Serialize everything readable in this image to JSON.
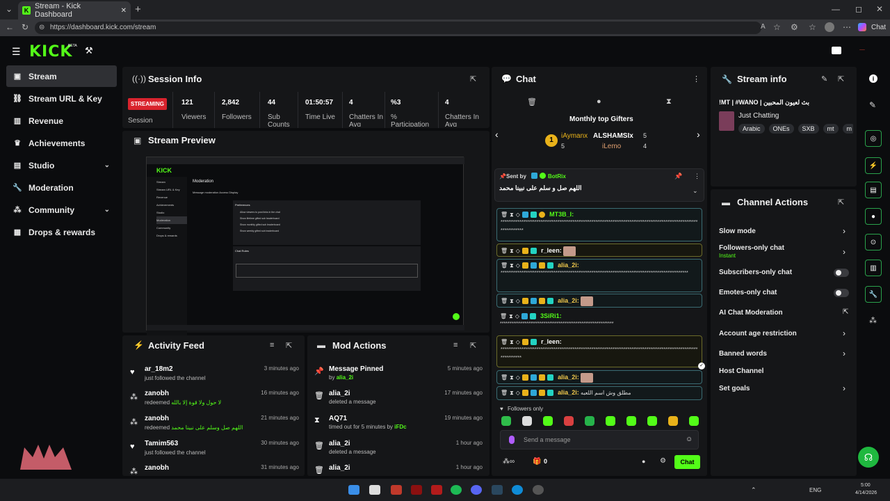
{
  "browser": {
    "tab_title": "Stream - Kick Dashboard",
    "url": "https://dashboard.kick.com/stream",
    "profile_label": "Chat",
    "new_tab": "+",
    "close_tab": "✕"
  },
  "brand": {
    "logo": "KICK",
    "beta": "BETA",
    "accent": "#53fc18"
  },
  "sidebar": {
    "items": [
      {
        "label": "Stream",
        "icon": "stream-icon"
      },
      {
        "label": "Stream URL & Key",
        "icon": "link-icon"
      },
      {
        "label": "Revenue",
        "icon": "chart-icon"
      },
      {
        "label": "Achievements",
        "icon": "trophy-icon"
      },
      {
        "label": "Studio",
        "icon": "studio-icon"
      },
      {
        "label": "Moderation",
        "icon": "wrench-icon"
      },
      {
        "label": "Community",
        "icon": "community-icon"
      },
      {
        "label": "Drops & rewards",
        "icon": "drops-icon"
      }
    ]
  },
  "session": {
    "title": "Session Info",
    "status": "STREAMING",
    "status_label": "Session",
    "stats": [
      {
        "value": "121",
        "label": "Viewers"
      },
      {
        "value": "2,842",
        "label": "Followers"
      },
      {
        "value": "44",
        "label": "Sub Counts"
      },
      {
        "value": "01:50:57",
        "label": "Time Live"
      },
      {
        "value": "4",
        "label": "Chatters In Avg"
      },
      {
        "value": "%3",
        "label": "% Participation"
      },
      {
        "value": "4",
        "label": "Chatters In Avg"
      }
    ]
  },
  "preview": {
    "title": "Stream Preview",
    "inner": {
      "heading": "Moderation",
      "tabs": "Message moderation  Access  Display",
      "section": "Preferences",
      "prefs": [
        "Allow viewers to post links in the chat",
        "Show lifetime gifted sub leaderboard",
        "Show monthly gifted sub leaderboard",
        "Show weekly gifted sub leaderboard"
      ],
      "rules": "Chat Rules",
      "nav": [
        "Stream",
        "Stream URL & Key",
        "Revenue",
        "Achievements",
        "Studio",
        "Moderation",
        "Community",
        "Drops & rewards"
      ]
    }
  },
  "activity": {
    "title": "Activity Feed",
    "rows": [
      {
        "user": "ar_18m2",
        "text": "just followed the channel",
        "time": "3 minutes ago"
      },
      {
        "user": "zanobh",
        "text": "redeemed",
        "extra": "لا حول ولا قوة إلا بالله",
        "time": "16 minutes ago"
      },
      {
        "user": "zanobh",
        "text": "redeemed",
        "extra": "اللهم صل وسلم على نبينا محمد",
        "time": "21 minutes ago"
      },
      {
        "user": "Tamim563",
        "text": "just followed the channel",
        "time": "30 minutes ago"
      },
      {
        "user": "zanobh",
        "text": "",
        "time": "31 minutes ago"
      }
    ]
  },
  "mod_actions": {
    "title": "Mod Actions",
    "rows": [
      {
        "title": "Message Pinned",
        "text": "by",
        "who": "alia_2i",
        "time": "5 minutes ago"
      },
      {
        "title": "alia_2i",
        "text": "deleted a message",
        "time": "17 minutes ago"
      },
      {
        "title": "AQ71",
        "text": "timed out for 5 minutes by",
        "who": "iFDc",
        "time": "19 minutes ago"
      },
      {
        "title": "alia_2i",
        "text": "deleted a message",
        "time": "1 hour ago"
      },
      {
        "title": "alia_2i",
        "text": "",
        "time": "1 hour ago"
      }
    ]
  },
  "chat": {
    "title": "Chat",
    "gifters_title": "Monthly top Gifters",
    "gifters": [
      {
        "rank": "1",
        "name": "iAymanx",
        "count": "5"
      },
      {
        "name": "ALSHAMSIx",
        "count": "5"
      },
      {
        "name": "iLemo",
        "count": "4"
      }
    ],
    "pinned": {
      "label": "Sent by",
      "user": "BotRix",
      "text": "اللهم صل و سلم على نبينا محمد"
    },
    "messages": [
      {
        "user": "MT3B_I:",
        "text": "********************************************************************************************************************"
      },
      {
        "user": "r_leen:",
        "text": ""
      },
      {
        "user": "alia_2i:",
        "text": "***************************************************************************************************"
      },
      {
        "user": "alia_2i:",
        "text": ""
      },
      {
        "user": "3SiRi1:",
        "text": "************************************************************"
      },
      {
        "user": "r_leen:",
        "text": "*******************************************************************************************************************"
      },
      {
        "user": "alia_2i:",
        "text": ""
      },
      {
        "user": "alia_2i:",
        "text": "مطلق وش اسم اللعبه"
      }
    ],
    "mode": "Followers only",
    "placeholder": "Send a message",
    "count": "0",
    "send_label": "Chat"
  },
  "stream_info": {
    "title": "Stream info",
    "stream_title": "!MT | #WANO | بث لعيون المحبين",
    "category": "Just Chatting",
    "tags": [
      "Arabic",
      "ONEs",
      "SXB",
      "mt",
      "m"
    ]
  },
  "channel_actions": {
    "title": "Channel Actions",
    "items": [
      {
        "label": "Slow mode"
      },
      {
        "label": "Followers-only chat",
        "sub": "Instant"
      },
      {
        "label": "Subscribers-only chat"
      },
      {
        "label": "Emotes-only chat"
      },
      {
        "label": "AI Chat Moderation"
      },
      {
        "label": "Account age restriction"
      },
      {
        "label": "Banned words"
      },
      {
        "label": "Host Channel"
      },
      {
        "label": "Set goals"
      }
    ]
  },
  "taskbar": {
    "lang": "ENG",
    "time": "5:00",
    "date": "4/14/2026"
  }
}
